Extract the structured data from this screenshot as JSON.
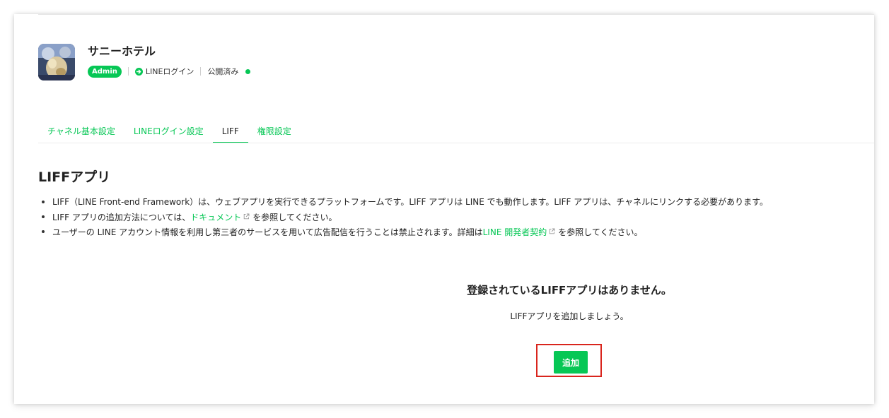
{
  "channel": {
    "name": "サニーホテル",
    "role_badge": "Admin",
    "channel_type": "LINEログイン",
    "status": "公開済み",
    "status_color": "#06c755"
  },
  "tabs": [
    {
      "label": "チャネル基本設定",
      "active": false
    },
    {
      "label": "LINEログイン設定",
      "active": false
    },
    {
      "label": "LIFF",
      "active": true
    },
    {
      "label": "権限設定",
      "active": false
    }
  ],
  "section": {
    "title": "LIFFアプリ",
    "notes": [
      {
        "text": "LIFF（LINE Front-end Framework）は、ウェブアプリを実行できるプラットフォームです。LIFF アプリは LINE でも動作します。LIFF アプリは、チャネルにリンクする必要があります。"
      },
      {
        "before": "LIFF アプリの追加方法については、",
        "link": "ドキュメント",
        "after": "を参照してください。"
      },
      {
        "before": "ユーザーの LINE アカウント情報を利用し第三者のサービスを用いて広告配信を行うことは禁止されます。詳細は",
        "link": "LINE 開発者契約",
        "after": "を参照してください。"
      }
    ]
  },
  "empty_state": {
    "title": "登録されているLIFFアプリはありません。",
    "subtitle": "LIFFアプリを追加しましょう。",
    "add_button": "追加"
  },
  "colors": {
    "accent": "#06c755",
    "highlight_border": "#d9251d"
  }
}
